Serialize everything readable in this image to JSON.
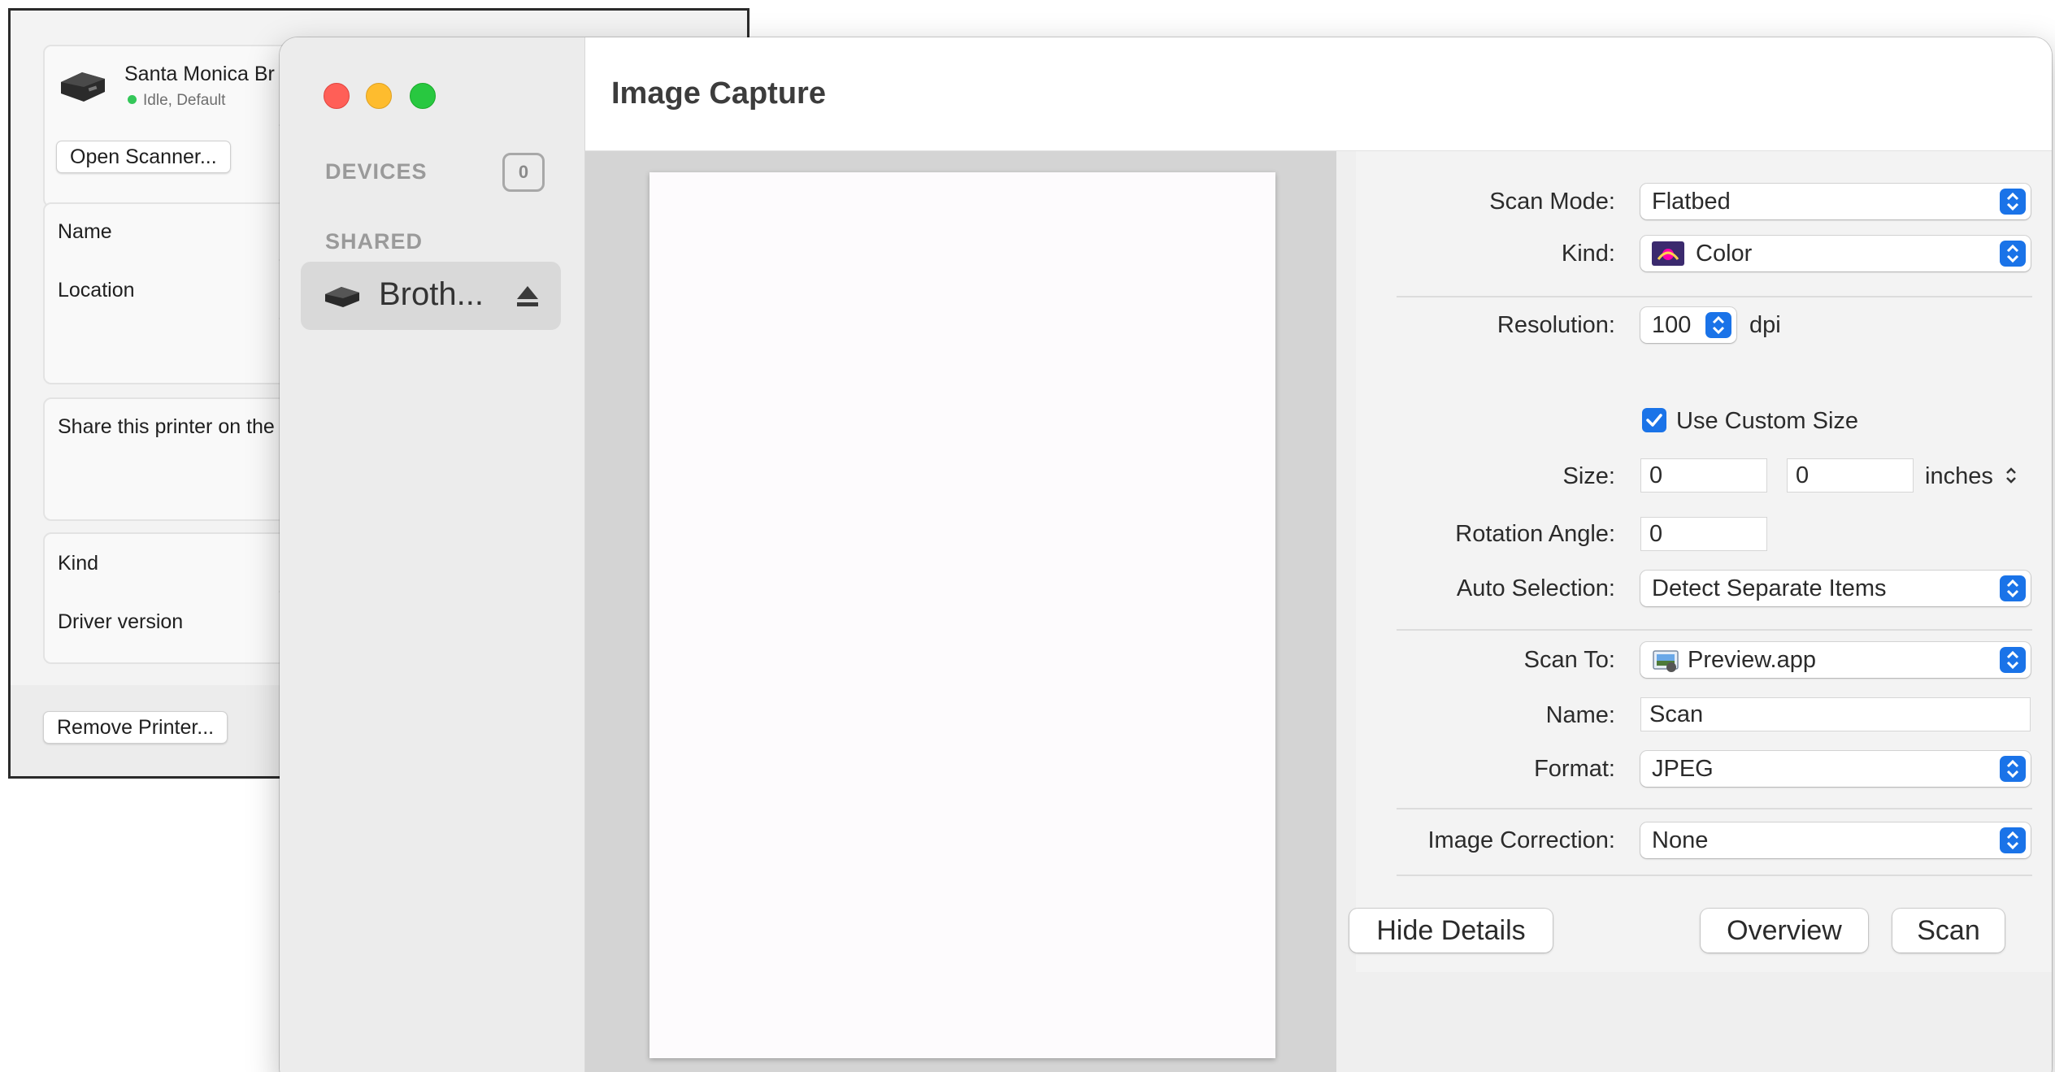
{
  "printer_settings": {
    "printer_name": "Santa Monica Br",
    "status": "Idle, Default",
    "open_scanner_label": "Open Scanner...",
    "fields": {
      "name_label": "Name",
      "location_label": "Location",
      "share_label": "Share this printer on the",
      "kind_label": "Kind",
      "driver_label": "Driver version"
    },
    "remove_printer_label": "Remove Printer...",
    "status_color": "#34c759"
  },
  "image_capture": {
    "title": "Image Capture",
    "sidebar": {
      "devices_header": "DEVICES",
      "devices_count": "0",
      "shared_header": "SHARED",
      "shared_device_name": "Broth...",
      "icons": [
        "printer-icon",
        "eject-icon"
      ]
    },
    "details": {
      "scan_mode": {
        "label": "Scan Mode:",
        "value": "Flatbed"
      },
      "kind": {
        "label": "Kind:",
        "value": "Color"
      },
      "resolution": {
        "label": "Resolution:",
        "value": "100",
        "unit": "dpi"
      },
      "use_custom_size": {
        "label": "Use Custom Size",
        "checked": true
      },
      "size": {
        "label": "Size:",
        "width": "0",
        "height": "0",
        "unit": "inches"
      },
      "rotation_angle": {
        "label": "Rotation Angle:",
        "value": "0"
      },
      "auto_selection": {
        "label": "Auto Selection:",
        "value": "Detect Separate Items"
      },
      "scan_to": {
        "label": "Scan To:",
        "value": "Preview.app"
      },
      "name": {
        "label": "Name:",
        "value": "Scan"
      },
      "format": {
        "label": "Format:",
        "value": "JPEG"
      },
      "image_correction": {
        "label": "Image Correction:",
        "value": "None"
      }
    },
    "buttons": {
      "hide_details": "Hide Details",
      "overview": "Overview",
      "scan": "Scan"
    },
    "accent_color": "#1a73e8",
    "traffic_lights": {
      "close": "#ff5f57",
      "minimize": "#febc2e",
      "zoom": "#28c840"
    }
  }
}
